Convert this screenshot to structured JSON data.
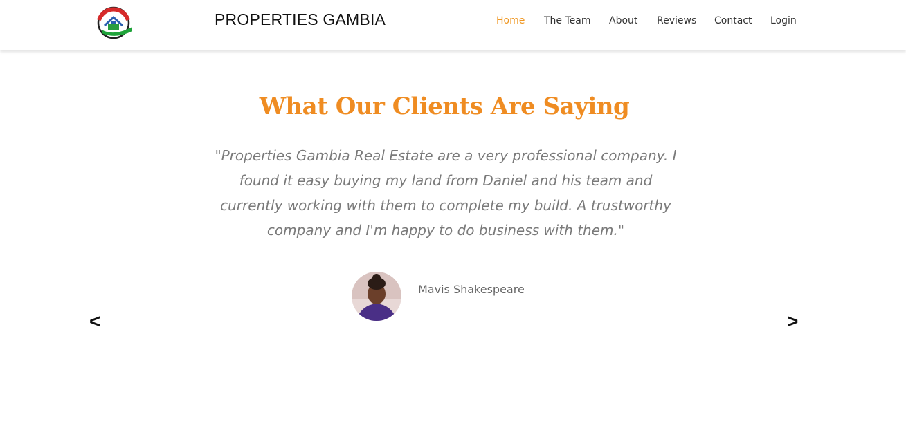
{
  "brand": {
    "title": "PROPERTIES GAMBIA"
  },
  "nav": {
    "items": [
      "Home",
      "The Team",
      "About",
      "Reviews",
      "Contact",
      "Login"
    ],
    "active": "Home"
  },
  "testimonials": {
    "heading": "What Our Clients Are Saying",
    "quote": "\"Properties Gambia Real Estate are a very professional company. I found it easy buying my land from Daniel and his team and currently working with them to complete my build. A trustworthy company and I'm happy to do business with them.\"",
    "author": "Mavis Shakespeare",
    "prev_label": "<",
    "next_label": ">"
  },
  "colors": {
    "accent": "#ef8c22",
    "nav_active": "#ef9722",
    "quote_text": "#7a7a7a"
  }
}
